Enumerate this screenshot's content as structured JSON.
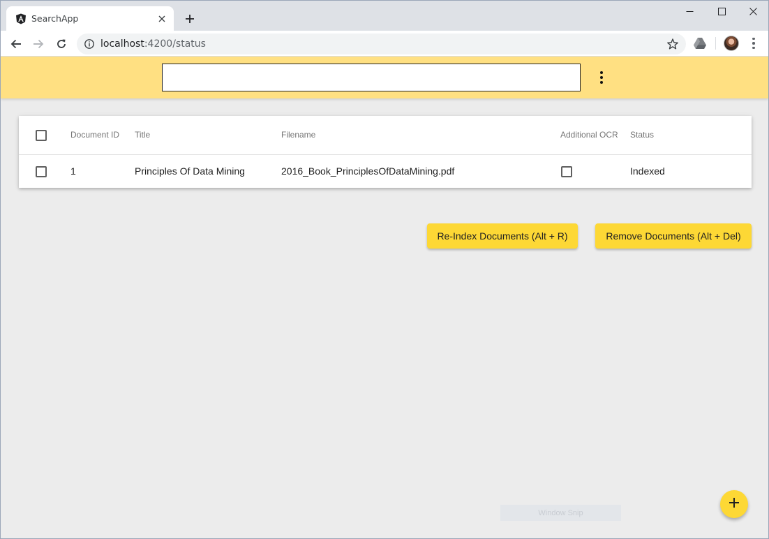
{
  "browser": {
    "tab": {
      "title": "SearchApp",
      "favicon": "angular-icon"
    },
    "url_host": "localhost",
    "url_path": ":4200/status",
    "window_controls": [
      "minimize-icon",
      "maximize-icon",
      "close-icon"
    ]
  },
  "app": {
    "search": {
      "value": "",
      "placeholder": ""
    },
    "menu_icon": "more-vert-icon"
  },
  "table": {
    "columns": [
      "Document ID",
      "Title",
      "Filename",
      "Additional OCR",
      "Status"
    ],
    "rows": [
      {
        "selected": false,
        "document_id": "1",
        "title": "Principles Of Data Mining",
        "filename": "2016_Book_PrinciplesOfDataMining.pdf",
        "additional_ocr": false,
        "status": "Indexed"
      }
    ]
  },
  "actions": {
    "reindex_label": "Re-Index Documents (Alt + R)",
    "remove_label": "Remove Documents (Alt + Del)"
  },
  "fab": {
    "icon": "add-icon"
  },
  "watermark": {
    "text": "Window Snip"
  },
  "colors": {
    "header_bg": "#ffe082",
    "button_bg": "#fdd835",
    "page_bg": "#ececec"
  }
}
